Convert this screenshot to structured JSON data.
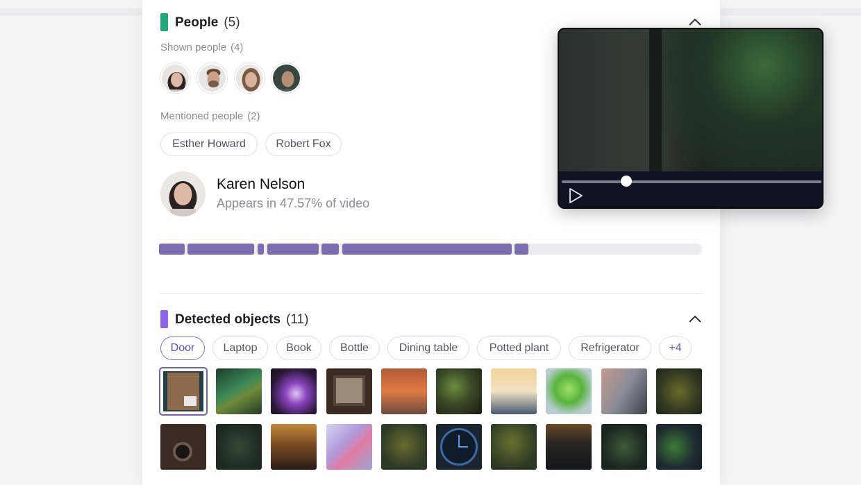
{
  "people": {
    "title": "People",
    "count": "(5)",
    "accent": "#1fa97a",
    "shown_label": "Shown people",
    "shown_count": "(4)",
    "avatars": [
      "person-1",
      "person-2",
      "person-3",
      "person-4"
    ],
    "mentioned_label": "Mentioned people",
    "mentioned_count": "(2)",
    "mentioned": [
      "Esther Howard",
      "Robert Fox"
    ],
    "selected": {
      "name": "Karen Nelson",
      "appearance": "Appears in 47.57% of video",
      "appearance_fraction": 0.4757
    }
  },
  "objects": {
    "title": "Detected objects",
    "count": "(11)",
    "accent": "#8b62e8",
    "filters": [
      "Door",
      "Laptop",
      "Book",
      "Bottle",
      "Dining table",
      "Potted plant",
      "Refrigerator",
      "+4"
    ],
    "active_filter": "Door"
  },
  "video": {
    "progress_fraction": 0.25,
    "state": "paused"
  },
  "colors": {
    "timeline": "#7a6db0",
    "selected": "#6f63b8"
  }
}
